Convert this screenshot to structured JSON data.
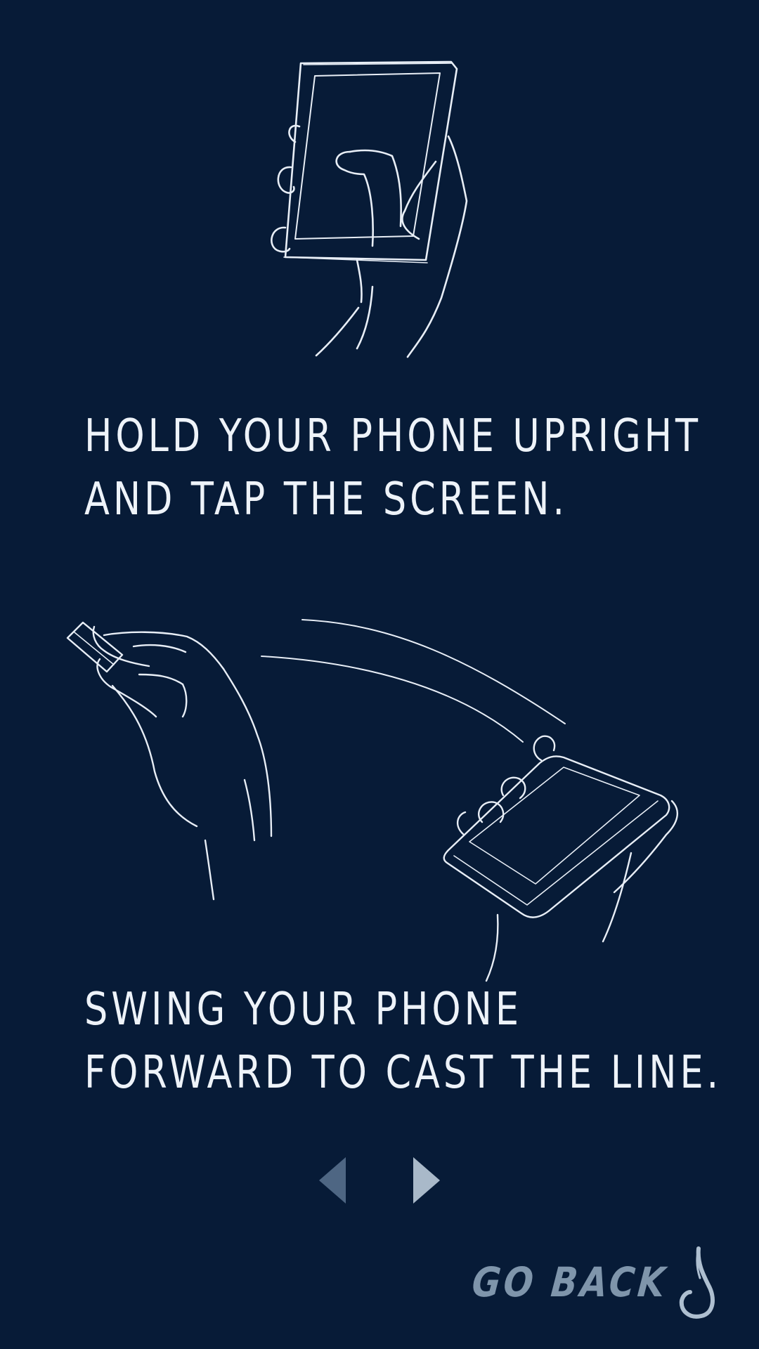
{
  "instructions": {
    "step1": {
      "line1": "HOLD YOUR PHONE UPRIGHT",
      "line2": "AND TAP THE SCREEN."
    },
    "step2": {
      "line1": "SWING YOUR PHONE",
      "line2": "FORWARD TO CAST THE LINE."
    }
  },
  "pager": {
    "prev_icon": "chevron-left-icon",
    "next_icon": "chevron-right-icon"
  },
  "footer": {
    "go_back_label": "GO BACK",
    "icon": "fish-hook-icon"
  },
  "colors": {
    "background": "#071b37",
    "text": "#eef3f9",
    "go_back": "#7f95ab",
    "arrow_prev": "#4e6683",
    "arrow_next": "#a9b9c9"
  }
}
